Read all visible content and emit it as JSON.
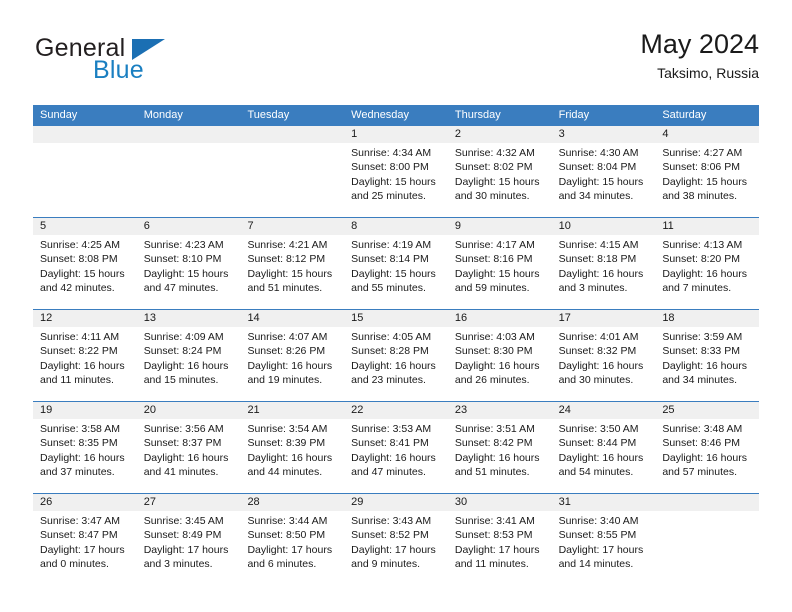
{
  "brand": {
    "word1": "General",
    "word2": "Blue",
    "triangle_color": "#1b6fb3",
    "blue_color": "#1a7fc1"
  },
  "header": {
    "title": "May 2024",
    "location": "Taksimo, Russia"
  },
  "theme": {
    "header_blue": "#3a7dbf",
    "date_strip_gray": "#f0f0f0",
    "text": "#1a1a1a"
  },
  "weekday_headers": [
    "Sunday",
    "Monday",
    "Tuesday",
    "Wednesday",
    "Thursday",
    "Friday",
    "Saturday"
  ],
  "weeks": [
    {
      "days": [
        {
          "num": "",
          "lines": [
            "",
            "",
            "",
            ""
          ],
          "empty": true
        },
        {
          "num": "",
          "lines": [
            "",
            "",
            "",
            ""
          ],
          "empty": true
        },
        {
          "num": "",
          "lines": [
            "",
            "",
            "",
            ""
          ],
          "empty": true
        },
        {
          "num": "1",
          "lines": [
            "Sunrise: 4:34 AM",
            "Sunset: 8:00 PM",
            "Daylight: 15 hours",
            "and 25 minutes."
          ],
          "empty": false
        },
        {
          "num": "2",
          "lines": [
            "Sunrise: 4:32 AM",
            "Sunset: 8:02 PM",
            "Daylight: 15 hours",
            "and 30 minutes."
          ],
          "empty": false
        },
        {
          "num": "3",
          "lines": [
            "Sunrise: 4:30 AM",
            "Sunset: 8:04 PM",
            "Daylight: 15 hours",
            "and 34 minutes."
          ],
          "empty": false
        },
        {
          "num": "4",
          "lines": [
            "Sunrise: 4:27 AM",
            "Sunset: 8:06 PM",
            "Daylight: 15 hours",
            "and 38 minutes."
          ],
          "empty": false
        }
      ]
    },
    {
      "days": [
        {
          "num": "5",
          "lines": [
            "Sunrise: 4:25 AM",
            "Sunset: 8:08 PM",
            "Daylight: 15 hours",
            "and 42 minutes."
          ],
          "empty": false
        },
        {
          "num": "6",
          "lines": [
            "Sunrise: 4:23 AM",
            "Sunset: 8:10 PM",
            "Daylight: 15 hours",
            "and 47 minutes."
          ],
          "empty": false
        },
        {
          "num": "7",
          "lines": [
            "Sunrise: 4:21 AM",
            "Sunset: 8:12 PM",
            "Daylight: 15 hours",
            "and 51 minutes."
          ],
          "empty": false
        },
        {
          "num": "8",
          "lines": [
            "Sunrise: 4:19 AM",
            "Sunset: 8:14 PM",
            "Daylight: 15 hours",
            "and 55 minutes."
          ],
          "empty": false
        },
        {
          "num": "9",
          "lines": [
            "Sunrise: 4:17 AM",
            "Sunset: 8:16 PM",
            "Daylight: 15 hours",
            "and 59 minutes."
          ],
          "empty": false
        },
        {
          "num": "10",
          "lines": [
            "Sunrise: 4:15 AM",
            "Sunset: 8:18 PM",
            "Daylight: 16 hours",
            "and 3 minutes."
          ],
          "empty": false
        },
        {
          "num": "11",
          "lines": [
            "Sunrise: 4:13 AM",
            "Sunset: 8:20 PM",
            "Daylight: 16 hours",
            "and 7 minutes."
          ],
          "empty": false
        }
      ]
    },
    {
      "days": [
        {
          "num": "12",
          "lines": [
            "Sunrise: 4:11 AM",
            "Sunset: 8:22 PM",
            "Daylight: 16 hours",
            "and 11 minutes."
          ],
          "empty": false
        },
        {
          "num": "13",
          "lines": [
            "Sunrise: 4:09 AM",
            "Sunset: 8:24 PM",
            "Daylight: 16 hours",
            "and 15 minutes."
          ],
          "empty": false
        },
        {
          "num": "14",
          "lines": [
            "Sunrise: 4:07 AM",
            "Sunset: 8:26 PM",
            "Daylight: 16 hours",
            "and 19 minutes."
          ],
          "empty": false
        },
        {
          "num": "15",
          "lines": [
            "Sunrise: 4:05 AM",
            "Sunset: 8:28 PM",
            "Daylight: 16 hours",
            "and 23 minutes."
          ],
          "empty": false
        },
        {
          "num": "16",
          "lines": [
            "Sunrise: 4:03 AM",
            "Sunset: 8:30 PM",
            "Daylight: 16 hours",
            "and 26 minutes."
          ],
          "empty": false
        },
        {
          "num": "17",
          "lines": [
            "Sunrise: 4:01 AM",
            "Sunset: 8:32 PM",
            "Daylight: 16 hours",
            "and 30 minutes."
          ],
          "empty": false
        },
        {
          "num": "18",
          "lines": [
            "Sunrise: 3:59 AM",
            "Sunset: 8:33 PM",
            "Daylight: 16 hours",
            "and 34 minutes."
          ],
          "empty": false
        }
      ]
    },
    {
      "days": [
        {
          "num": "19",
          "lines": [
            "Sunrise: 3:58 AM",
            "Sunset: 8:35 PM",
            "Daylight: 16 hours",
            "and 37 minutes."
          ],
          "empty": false
        },
        {
          "num": "20",
          "lines": [
            "Sunrise: 3:56 AM",
            "Sunset: 8:37 PM",
            "Daylight: 16 hours",
            "and 41 minutes."
          ],
          "empty": false
        },
        {
          "num": "21",
          "lines": [
            "Sunrise: 3:54 AM",
            "Sunset: 8:39 PM",
            "Daylight: 16 hours",
            "and 44 minutes."
          ],
          "empty": false
        },
        {
          "num": "22",
          "lines": [
            "Sunrise: 3:53 AM",
            "Sunset: 8:41 PM",
            "Daylight: 16 hours",
            "and 47 minutes."
          ],
          "empty": false
        },
        {
          "num": "23",
          "lines": [
            "Sunrise: 3:51 AM",
            "Sunset: 8:42 PM",
            "Daylight: 16 hours",
            "and 51 minutes."
          ],
          "empty": false
        },
        {
          "num": "24",
          "lines": [
            "Sunrise: 3:50 AM",
            "Sunset: 8:44 PM",
            "Daylight: 16 hours",
            "and 54 minutes."
          ],
          "empty": false
        },
        {
          "num": "25",
          "lines": [
            "Sunrise: 3:48 AM",
            "Sunset: 8:46 PM",
            "Daylight: 16 hours",
            "and 57 minutes."
          ],
          "empty": false
        }
      ]
    },
    {
      "days": [
        {
          "num": "26",
          "lines": [
            "Sunrise: 3:47 AM",
            "Sunset: 8:47 PM",
            "Daylight: 17 hours",
            "and 0 minutes."
          ],
          "empty": false
        },
        {
          "num": "27",
          "lines": [
            "Sunrise: 3:45 AM",
            "Sunset: 8:49 PM",
            "Daylight: 17 hours",
            "and 3 minutes."
          ],
          "empty": false
        },
        {
          "num": "28",
          "lines": [
            "Sunrise: 3:44 AM",
            "Sunset: 8:50 PM",
            "Daylight: 17 hours",
            "and 6 minutes."
          ],
          "empty": false
        },
        {
          "num": "29",
          "lines": [
            "Sunrise: 3:43 AM",
            "Sunset: 8:52 PM",
            "Daylight: 17 hours",
            "and 9 minutes."
          ],
          "empty": false
        },
        {
          "num": "30",
          "lines": [
            "Sunrise: 3:41 AM",
            "Sunset: 8:53 PM",
            "Daylight: 17 hours",
            "and 11 minutes."
          ],
          "empty": false
        },
        {
          "num": "31",
          "lines": [
            "Sunrise: 3:40 AM",
            "Sunset: 8:55 PM",
            "Daylight: 17 hours",
            "and 14 minutes."
          ],
          "empty": false
        },
        {
          "num": "",
          "lines": [
            "",
            "",
            "",
            ""
          ],
          "empty": true
        }
      ]
    }
  ]
}
